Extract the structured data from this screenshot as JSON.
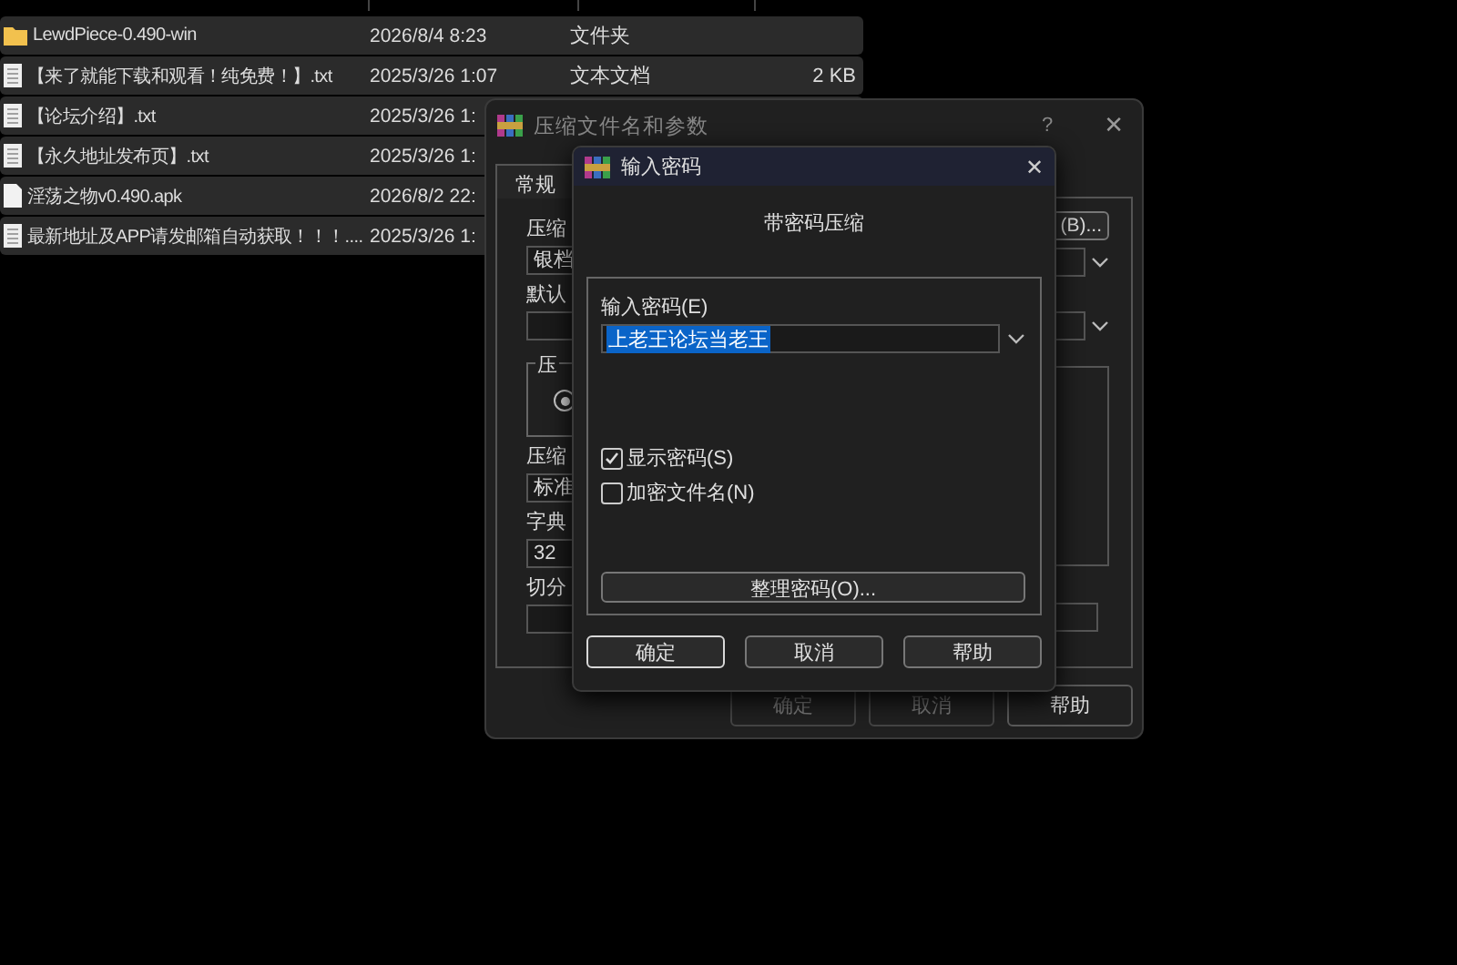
{
  "file_list": {
    "rows": [
      {
        "kind": "folder",
        "name": "LewdPiece-0.490-win",
        "date": "2026/8/4 8:23",
        "type": "文件夹",
        "selected": true
      },
      {
        "kind": "text",
        "name": "【来了就能下载和观看！纯免费！】.txt",
        "date": "2025/3/26 1:07",
        "type": "文本文档",
        "size": "2 KB",
        "selected": true
      },
      {
        "kind": "text",
        "name": "【论坛介绍】.txt",
        "date": "2025/3/26 1:",
        "selected": true
      },
      {
        "kind": "text",
        "name": "【永久地址发布页】.txt",
        "date": "2025/3/26 1:",
        "selected": true
      },
      {
        "kind": "file",
        "name": "淫荡之物v0.490.apk",
        "date": "2026/8/2 22:",
        "selected": true
      },
      {
        "kind": "text",
        "name": "最新地址及APP请发邮箱自动获取！！！....",
        "date": "2025/3/26 1:",
        "selected": true
      }
    ]
  },
  "archive_dialog": {
    "title": "压缩文件名和参数",
    "help": "?",
    "close": "✕",
    "tabs": [
      {
        "label": "常规",
        "selected": true
      }
    ],
    "left": [
      {
        "kind": "label",
        "text": "压缩"
      },
      {
        "kind": "field",
        "text": "银档"
      },
      {
        "kind": "label",
        "text": "默认"
      },
      {
        "kind": "field"
      },
      {
        "kind": "group",
        "text": "压",
        "selected": true
      },
      {
        "kind": "label",
        "text": "压缩"
      },
      {
        "kind": "field",
        "text": "标准"
      },
      {
        "kind": "label",
        "text": "字典"
      },
      {
        "kind": "field",
        "text": "32"
      },
      {
        "kind": "label",
        "text": "切分"
      },
      {
        "kind": "field"
      }
    ],
    "browse_button": "(B)...",
    "buttons": [
      {
        "label": "确定",
        "disabled": true
      },
      {
        "label": "取消",
        "disabled": true
      },
      {
        "label": "帮助",
        "disabled": false
      }
    ]
  },
  "password_dialog": {
    "title": "输入密码",
    "close": "✕",
    "heading": "带密码压缩",
    "password_label": "输入密码(E)",
    "password_value": "上老王论坛当老王",
    "checkboxes": [
      {
        "label": "显示密码(S)",
        "checked": true
      },
      {
        "label": "加密文件名(N)",
        "checked": false
      }
    ],
    "organize_button": "整理密码(O)...",
    "buttons": [
      {
        "label": "确定",
        "default": true
      },
      {
        "label": "取消",
        "default": false
      },
      {
        "label": "帮助",
        "default": false
      }
    ]
  }
}
